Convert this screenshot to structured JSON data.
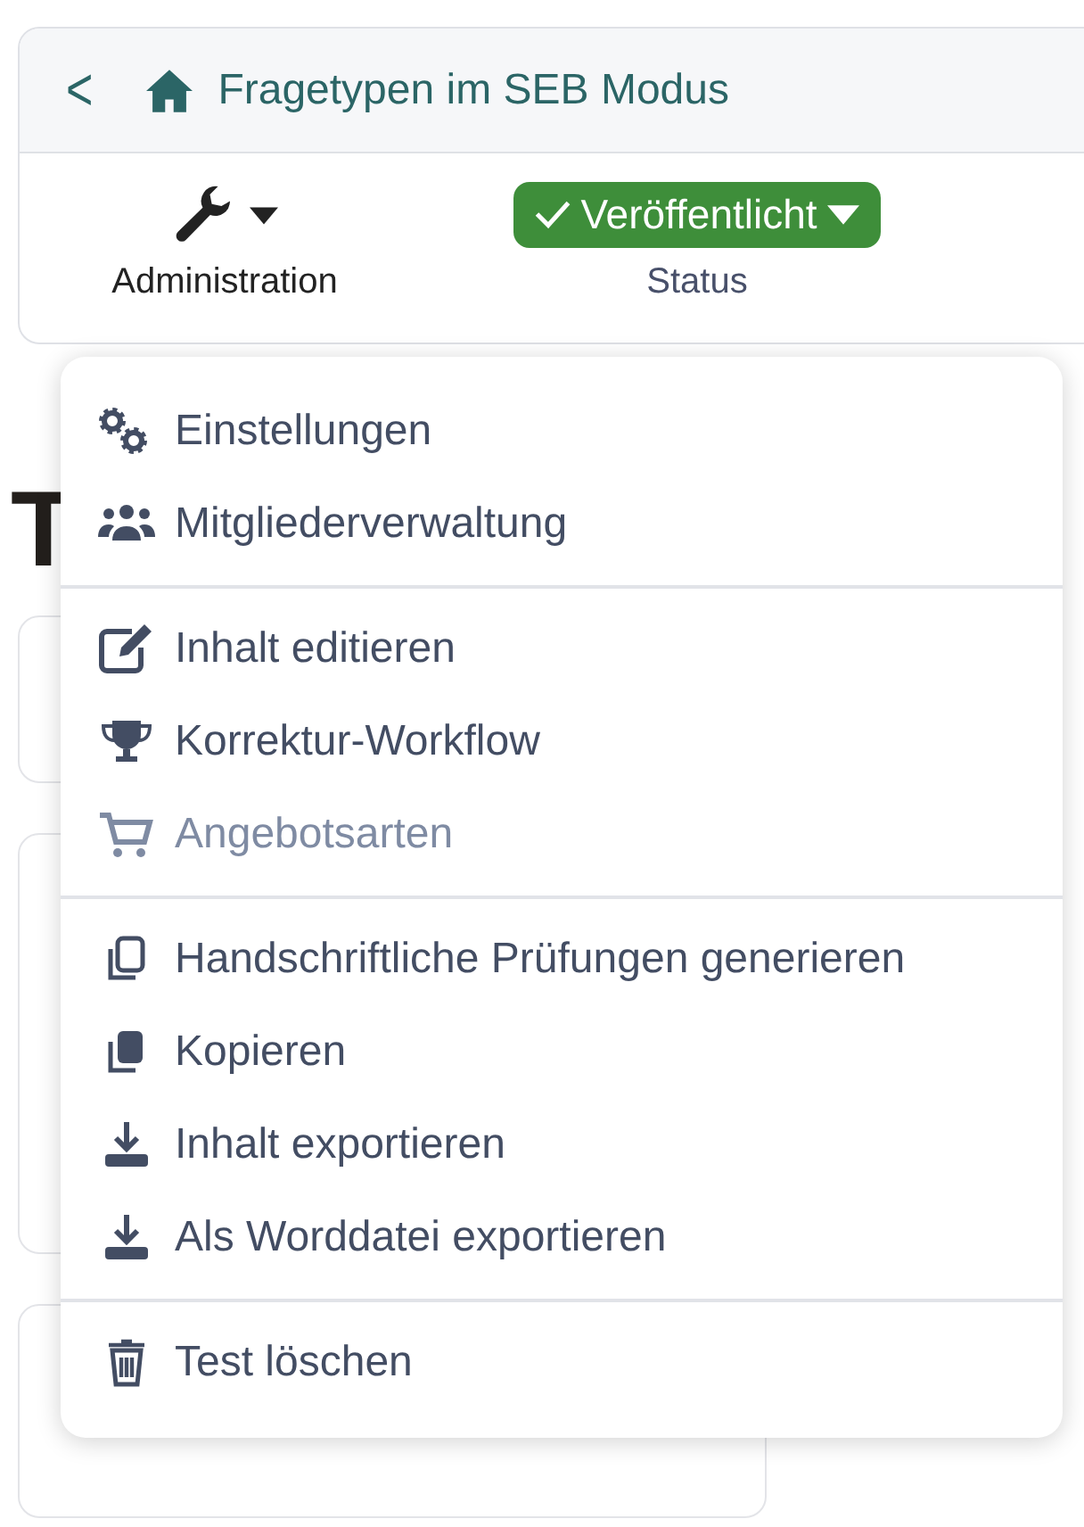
{
  "header": {
    "back_symbol": "<",
    "title": "Fragetypen im SEB Modus"
  },
  "toolbar": {
    "administration": {
      "label": "Administration",
      "expanded": true
    },
    "status": {
      "value": "Veröffentlicht",
      "label": "Status",
      "color": "#3e8e3a"
    }
  },
  "background": {
    "heading_start": "T"
  },
  "menu": {
    "groups": [
      [
        {
          "kind": "gears",
          "label": "Einstellungen",
          "disabled": false
        },
        {
          "kind": "users",
          "label": "Mitgliederverwaltung",
          "disabled": false
        }
      ],
      [
        {
          "kind": "edit",
          "label": "Inhalt editieren",
          "disabled": false
        },
        {
          "kind": "trophy",
          "label": "Korrektur-Workflow",
          "disabled": false
        },
        {
          "kind": "cart",
          "label": "Angebotsarten",
          "disabled": true
        }
      ],
      [
        {
          "kind": "copy-outline",
          "label": "Handschriftliche Prüfungen generieren",
          "disabled": false
        },
        {
          "kind": "copy",
          "label": "Kopieren",
          "disabled": false
        },
        {
          "kind": "download",
          "label": "Inhalt exportieren",
          "disabled": false
        },
        {
          "kind": "download",
          "label": "Als Worddatei exportieren",
          "disabled": false
        }
      ],
      [
        {
          "kind": "trash",
          "label": "Test löschen",
          "disabled": false
        }
      ]
    ]
  }
}
